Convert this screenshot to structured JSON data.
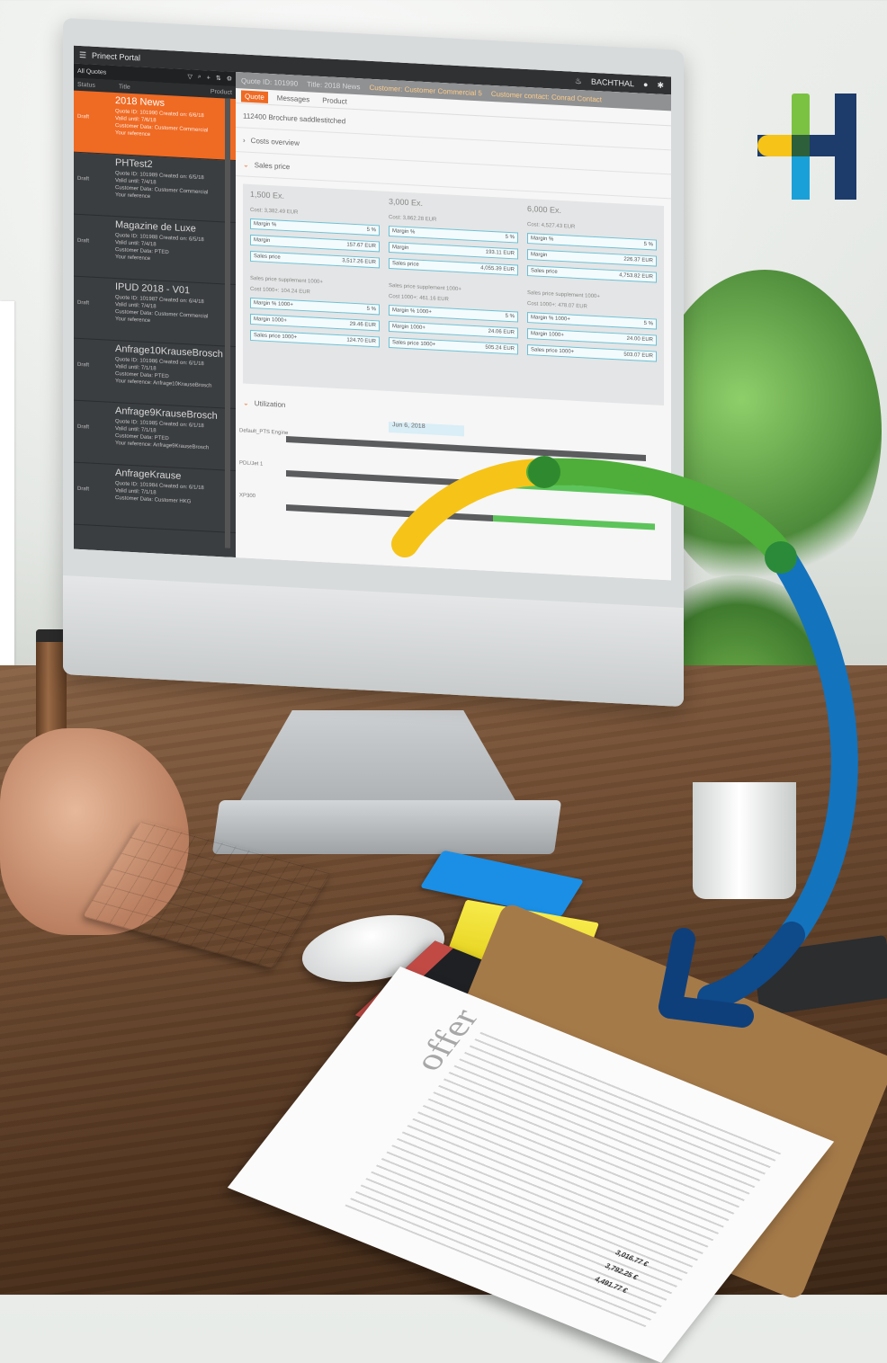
{
  "app": {
    "window_title": "Prinect Portal",
    "user": "BACHTHAL"
  },
  "left_pane": {
    "title": "All Quotes",
    "col_status": "Status",
    "col_title": "Title",
    "col_product": "Product",
    "quotes": [
      {
        "title": "2018 News",
        "status": "Draft",
        "meta1": "Quote ID: 101990  Created on: 6/6/18",
        "meta2": "Valid until: 7/6/18",
        "meta3": "Customer Data: Customer Commercial",
        "meta4": "Your reference",
        "active": true
      },
      {
        "title": "PHTest2",
        "status": "Draft",
        "meta1": "Quote ID: 101989  Created on: 6/5/18",
        "meta2": "Valid until: 7/4/18",
        "meta3": "Customer Data: Customer Commercial",
        "meta4": "Your reference",
        "active": false
      },
      {
        "title": "Magazine de Luxe",
        "status": "Draft",
        "meta1": "Quote ID: 101988  Created on: 6/5/18",
        "meta2": "Valid until: 7/4/18",
        "meta3": "Customer Data: PTED",
        "meta4": "Your reference",
        "active": false
      },
      {
        "title": "IPUD 2018 - V01",
        "status": "Draft",
        "meta1": "Quote ID: 101987  Created on: 6/4/18",
        "meta2": "Valid until: 7/4/18",
        "meta3": "Customer Data: Customer Commercial",
        "meta4": "Your reference",
        "active": false
      },
      {
        "title": "Anfrage10KrauseBrosch",
        "status": "Draft",
        "meta1": "Quote ID: 101986  Created on: 6/1/18",
        "meta2": "Valid until: 7/1/18",
        "meta3": "Customer Data: PTED",
        "meta4": "Your reference: Anfrage10KrauseBrosch",
        "active": false
      },
      {
        "title": "Anfrage9KrauseBrosch",
        "status": "Draft",
        "meta1": "Quote ID: 101985  Created on: 6/1/18",
        "meta2": "Valid until: 7/1/18",
        "meta3": "Customer Data: PTED",
        "meta4": "Your reference: Anfrage9KrauseBrosch",
        "active": false
      },
      {
        "title": "AnfrageKrause",
        "status": "Draft",
        "meta1": "Quote ID: 101984  Created on: 6/1/18",
        "meta2": "Valid until: 7/1/18",
        "meta3": "Customer Data: Customer HKG",
        "meta4": "",
        "active": false
      }
    ]
  },
  "right_pane": {
    "header_quote": "Quote ID: 101990",
    "header_title": "Title: 2018 News",
    "header_customer": "Customer: Customer Commercial 5",
    "header_contact": "Customer contact: Conrad Contact",
    "tabs": [
      "Quote",
      "Messages",
      "Product"
    ],
    "product_line": "112400 Brochure saddlestitched",
    "section_costs": "Costs overview",
    "section_sales": "Sales price",
    "section_util": "Utilization",
    "price_cols": [
      {
        "head": "1,500 Ex.",
        "cost": "Cost: 3,382.49 EUR",
        "margin_pct": "5 %",
        "margin": "157.67 EUR",
        "sales": "3,517.26 EUR",
        "sub": "Sales price supplement 1000+",
        "cost1000": "Cost 1000+: 104.24 EUR",
        "margin1000_pct": "5 %",
        "margin1000": "29.46 EUR",
        "sales1000": "124.70 EUR"
      },
      {
        "head": "3,000 Ex.",
        "cost": "Cost: 3,862.28 EUR",
        "margin_pct": "5 %",
        "margin": "193.11 EUR",
        "sales": "4,055.39 EUR",
        "sub": "Sales price supplement 1000+",
        "cost1000": "Cost 1000+: 461.16 EUR",
        "margin1000_pct": "5 %",
        "margin1000": "24.06 EUR",
        "sales1000": "505.24 EUR"
      },
      {
        "head": "6,000 Ex.",
        "cost": "Cost: 4,527.43 EUR",
        "margin_pct": "5 %",
        "margin": "226.37 EUR",
        "sales": "4,753.82 EUR",
        "sub": "Sales price supplement 1000+",
        "cost1000": "Cost 1000+: 478.07 EUR",
        "margin1000_pct": "5 %",
        "margin1000": "24.00 EUR",
        "sales1000": "503.07 EUR"
      }
    ],
    "timeline_date": "Jun 6, 2018",
    "timeline_rows": [
      "Default_PTS Engine",
      "PDL/Jet 1",
      "XP300"
    ]
  },
  "offer": {
    "word": "offer",
    "prices": [
      "3,016.77 €",
      "3,792.25 €",
      "4,491.77 €"
    ]
  },
  "colors": {
    "accent": "#ef6a23",
    "logo_green": "#7cc242",
    "logo_blue": "#1aa0d8",
    "logo_navy": "#1d3b6b",
    "logo_yellow": "#f6c318"
  }
}
